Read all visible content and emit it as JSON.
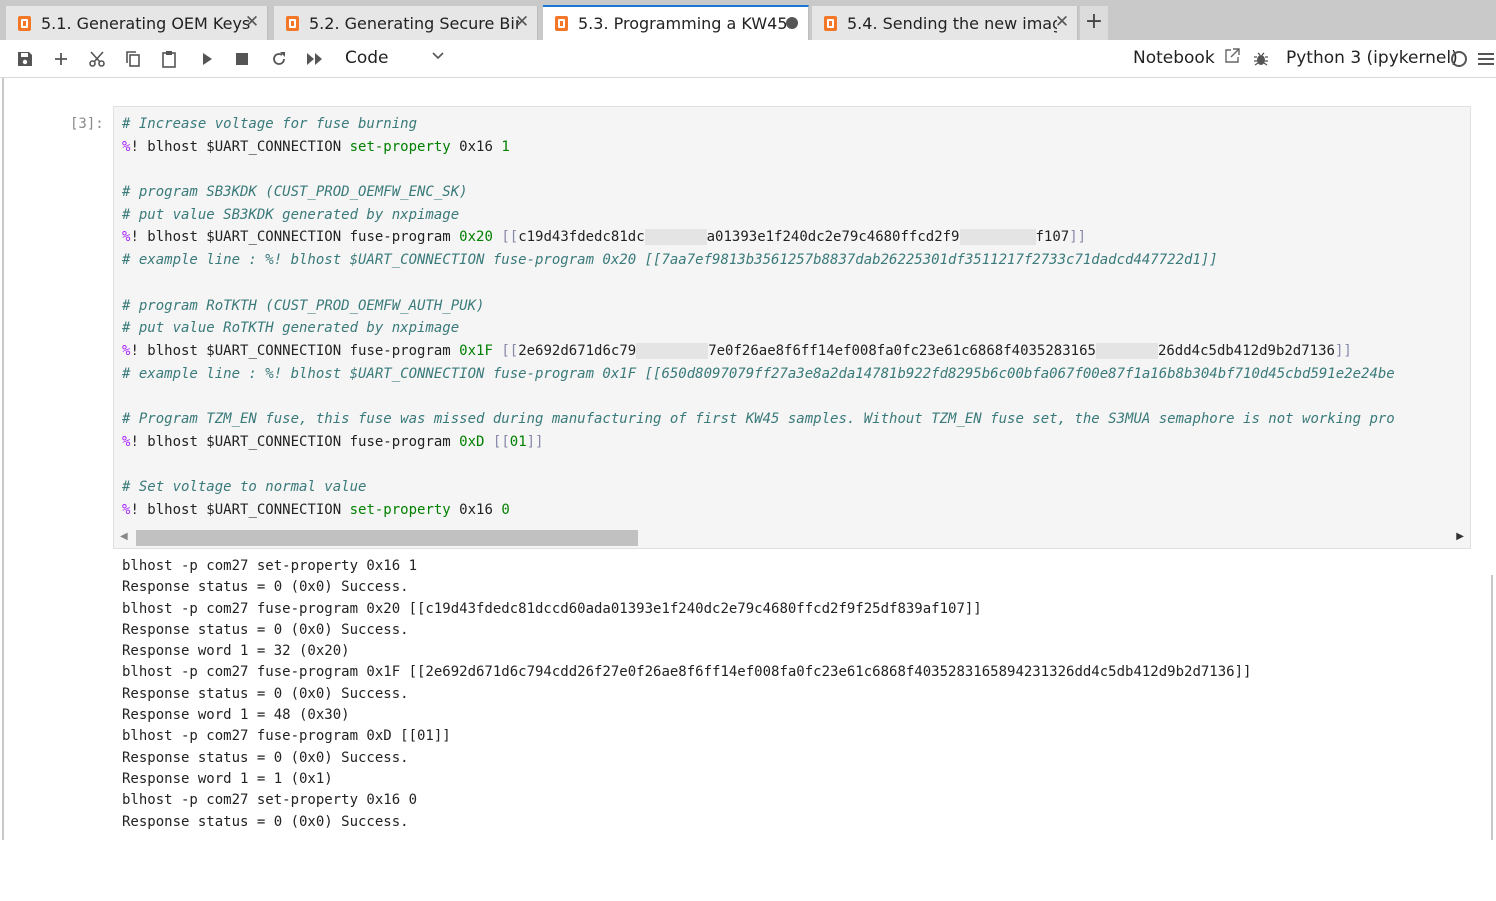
{
  "tabs": [
    {
      "label": "5.1. Generating OEM Keys",
      "close": "✕"
    },
    {
      "label": "5.2. Generating Secure Bin",
      "close": "✕"
    },
    {
      "label": "5.3. Programming a KW45",
      "modified": true
    },
    {
      "label": "5.4. Sending the new imag",
      "close": "✕"
    }
  ],
  "tab_add": "+",
  "toolbar": {
    "cell_type": "Code",
    "notebook_label": "Notebook",
    "kernel": "Python 3 (ipykernel)",
    "icons": [
      "save-icon",
      "add-icon",
      "cut-icon",
      "copy-icon",
      "paste-icon",
      "run-icon",
      "stop-icon",
      "restart-icon",
      "fast-forward-icon",
      "chevron-down-icon",
      "external-link-icon",
      "bug-icon",
      "kernel-status-icon",
      "menu-icon"
    ]
  },
  "cell": {
    "prompt": "[3]:",
    "lines": [
      {
        "t": "comment",
        "text": "# Increase voltage for fuse burning"
      },
      {
        "t": "code",
        "magic": "%",
        "cmd": "! blhost $UART_CONNECTION ",
        "prop": "set-property",
        "rest": " 0x16 ",
        "num": "1"
      },
      {
        "t": "blank"
      },
      {
        "t": "comment",
        "text": "# program SB3KDK (CUST_PROD_OEMFW_ENC_SK)"
      },
      {
        "t": "comment",
        "text": "# put value SB3KDK generated by nxpimage"
      },
      {
        "t": "fuse",
        "magic": "%",
        "cmd": "! blhost $UART_CONNECTION fuse-program ",
        "addr": "0x20",
        "open": " [[",
        "v1": "c19d43fdedc81dc",
        "r1": 62,
        "v2": "a01393e1f240dc2e79c4680ffcd2f9",
        "r2": 76,
        "v3": "f107",
        "close": "]]"
      },
      {
        "t": "comment",
        "text": "# example line : %! blhost $UART_CONNECTION fuse-program 0x20 [[7aa7ef9813b3561257b8837dab26225301df3511217f2733c71dadcd447722d1]]"
      },
      {
        "t": "blank"
      },
      {
        "t": "comment",
        "text": "# program RoTKTH (CUST_PROD_OEMFW_AUTH_PUK)"
      },
      {
        "t": "comment",
        "text": "# put value RoTKTH generated by nxpimage"
      },
      {
        "t": "fuse",
        "magic": "%",
        "cmd": "! blhost $UART_CONNECTION fuse-program ",
        "addr": "0x1F",
        "open": " [[",
        "v1": "2e692d671d6c79",
        "r1": 72,
        "v2": "7e0f26ae8f6ff14ef008fa0fc23e61c6868f4035283165",
        "r2": 62,
        "v3": "26dd4c5db412d9b2d7136",
        "close": "]]"
      },
      {
        "t": "comment",
        "text": "# example line : %! blhost $UART_CONNECTION fuse-program 0x1F [[650d8097079ff27a3e8a2da14781b922fd8295b6c00bfa067f00e87f1a16b8b304bf710d45cbd591e2e24be"
      },
      {
        "t": "blank"
      },
      {
        "t": "comment",
        "text": "# Program TZM_EN fuse, this fuse was missed during manufacturing of first KW45 samples. Without TZM_EN fuse set, the S3MUA semaphore is not working pro"
      },
      {
        "t": "fuse2",
        "magic": "%",
        "cmd": "! blhost $UART_CONNECTION fuse-program ",
        "addr": "0xD",
        "open": " [[",
        "v1": "01",
        "close": "]]"
      },
      {
        "t": "blank"
      },
      {
        "t": "comment",
        "text": "# Set voltage to normal value"
      },
      {
        "t": "code",
        "magic": "%",
        "cmd": "! blhost $UART_CONNECTION ",
        "prop": "set-property",
        "rest": " 0x16 ",
        "num": "0"
      }
    ]
  },
  "output": [
    "blhost -p com27 set-property 0x16 1",
    "Response status = 0 (0x0) Success.",
    "blhost -p com27 fuse-program 0x20 [[c19d43fdedc81dccd60ada01393e1f240dc2e79c4680ffcd2f9f25df839af107]]",
    "Response status = 0 (0x0) Success.",
    "Response word 1 = 32 (0x20)",
    "blhost -p com27 fuse-program 0x1F [[2e692d671d6c794cdd26f27e0f26ae8f6ff14ef008fa0fc23e61c6868f4035283165894231326dd4c5db412d9b2d7136]]",
    "Response status = 0 (0x0) Success.",
    "Response word 1 = 48 (0x30)",
    "blhost -p com27 fuse-program 0xD [[01]]",
    "Response status = 0 (0x0) Success.",
    "Response word 1 = 1 (0x1)",
    "blhost -p com27 set-property 0x16 0",
    "Response status = 0 (0x0) Success."
  ],
  "colors": {
    "accent": "#1976d2",
    "notebook_icon": "#f37726",
    "comment": "#3a7a7a",
    "magic": "#aa22ff",
    "keyword": "#008000"
  }
}
